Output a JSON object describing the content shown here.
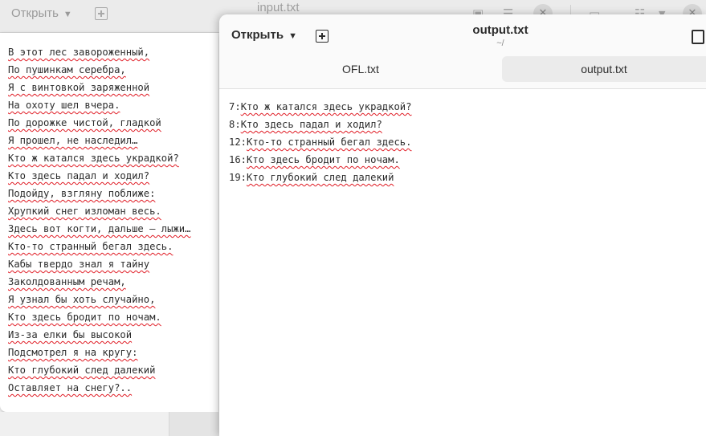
{
  "background_window": {
    "open_label": "Открыть",
    "title": "input.txt",
    "lines": [
      "В этот лес завороженный,",
      "По пушинкам серебра,",
      "Я с винтовкой заряженной",
      "На охоту шел вчера.",
      "По дорожке чистой, гладкой",
      "Я прошел, не наследил…",
      "Кто ж катался здесь украдкой?",
      "Кто здесь падал и ходил?",
      "Подойду, взгляну поближе:",
      "Хрупкий снег изломан весь.",
      "Здесь вот когти, дальше — лыжи…",
      "Кто-то странный бегал здесь.",
      "Кабы твердо знал я тайну",
      "Заколдованным речам,",
      "Я узнал бы хоть случайно,",
      "Кто здесь бродит по ночам.",
      "Из-за елки бы высокой",
      "Подсмотрел я на кругу:",
      "Кто глубокий след далекий",
      "Оставляет на снегу?.."
    ]
  },
  "front_window": {
    "open_label": "Открыть",
    "title": "output.txt",
    "subtitle": "~/",
    "tabs": [
      {
        "label": "OFL.txt",
        "active": false
      },
      {
        "label": "output.txt",
        "active": true
      }
    ],
    "output_lines": [
      {
        "num": "7:",
        "text": "Кто ж катался здесь украдкой?"
      },
      {
        "num": "8:",
        "text": "Кто здесь падал и ходил?"
      },
      {
        "num": "12:",
        "text": "Кто-то странный бегал здесь."
      },
      {
        "num": "16:",
        "text": "Кто здесь бродит по ночам."
      },
      {
        "num": "19:",
        "text": "Кто глубокий след далекий"
      }
    ]
  },
  "icons": [
    "add-tab-icon",
    "chevron-down-icon",
    "save-icon",
    "menu-icon",
    "close-icon",
    "folder-icon",
    "list-icon"
  ],
  "colors": {
    "spellcheck": "#e01b24",
    "active_tab": "#ebebeb"
  }
}
